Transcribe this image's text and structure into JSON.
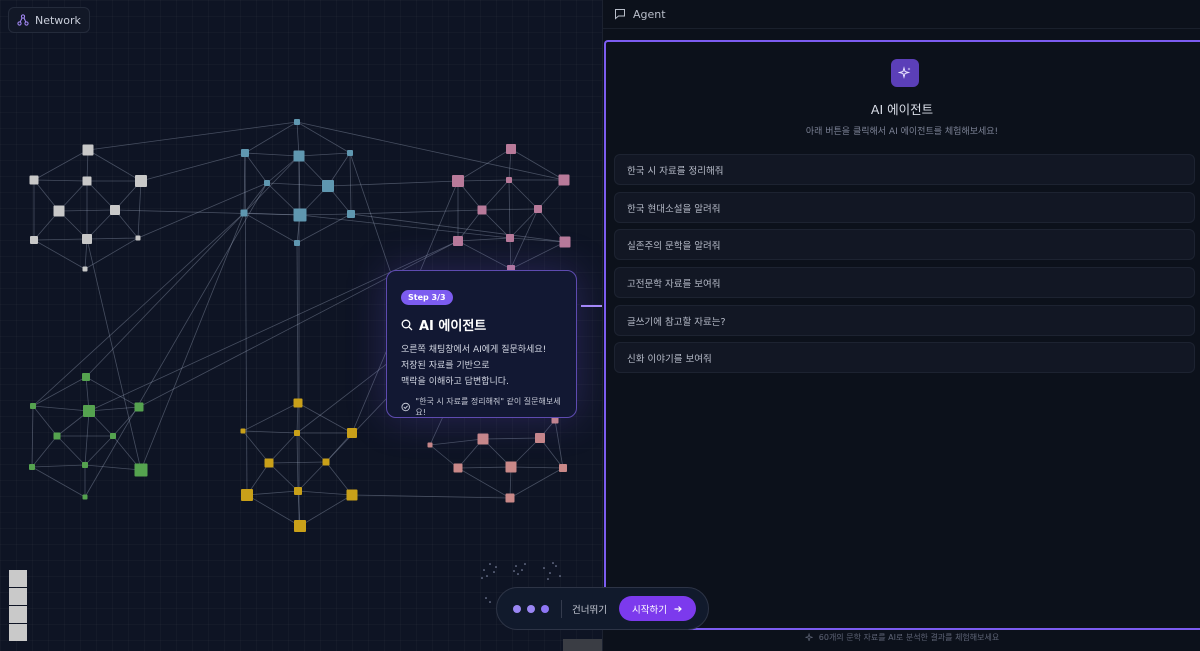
{
  "network_panel": {
    "title": "Network",
    "icon": "network-icon"
  },
  "tooltip": {
    "step": "Step 3/3",
    "title": "AI 에이전트",
    "title_icon": "search-icon",
    "body_lines": [
      "오른쪽 채팅창에서 AI에게 질문하세요!",
      "저장된 자료를 기반으로",
      "맥락을 이해하고 답변합니다."
    ],
    "hint": "\"한국 시 자료를 정리해줘\" 같이 질문해보세요!",
    "hint_icon": "check-circle-icon"
  },
  "agent": {
    "header": "Agent",
    "header_icon": "chat-icon",
    "title": "AI 에이전트",
    "subtitle": "아래 버튼을 클릭해서 AI 에이전트를 체험해보세요!",
    "logo_icon": "sparkles-icon",
    "suggestions": [
      "한국 시 자료를 정리해줘",
      "한국 현대소설을 알려줘",
      "실존주의 문학을 알려줘",
      "고전문학 자료를 보여줘",
      "글쓰기에 참고할 자료는?",
      "신화 이야기를 보여줘"
    ],
    "footer": "60개의 문학 자료를 AI로 분석한 결과를 체험해보세요"
  },
  "tour_controls": {
    "skip": "건너뛰기",
    "start": "시작하기",
    "total_steps": 3,
    "current_step": 3
  },
  "colors": {
    "accent": "#7c5cf0",
    "start_button": "#7c3aed",
    "cluster_gray": "#c8c8c8",
    "cluster_blue": "#5f97b0",
    "cluster_pink": "#b87a9a",
    "cluster_green": "#55a34f",
    "cluster_yellow": "#c9a019",
    "cluster_salmon": "#c98888"
  }
}
